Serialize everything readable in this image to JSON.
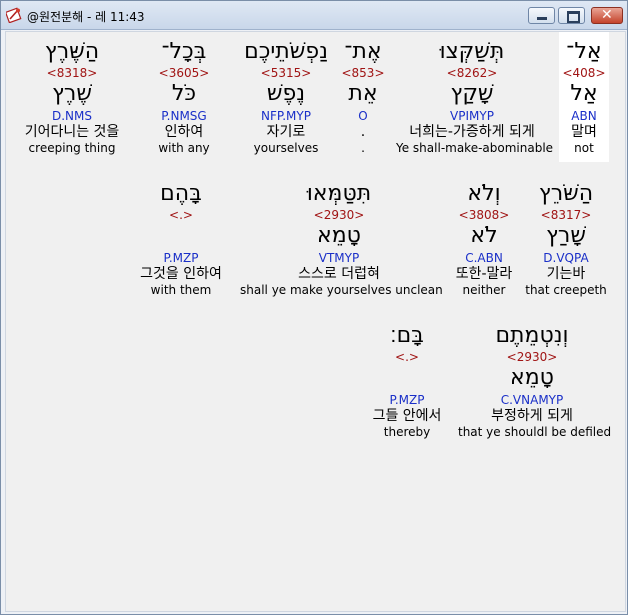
{
  "window": {
    "title": "@원전분해 - 레 11:43",
    "app_icon": "bible-parser-icon",
    "buttons": {
      "minimize": "minimize-icon",
      "maximize": "maximize-icon",
      "close": "✕"
    }
  },
  "rows": [
    [
      {
        "heb": "הַשֶּׁרֶץ",
        "strong": "<8318>",
        "lemma": "שֶׁרֶץ",
        "parse": "D.NMS",
        "kor": "기어다니는 것을",
        "eng": "creeping thing"
      },
      {
        "heb": "בְּכָל־",
        "strong": "<3605>",
        "lemma": "כֹּל",
        "parse": "P.NMSG",
        "kor": "인하여",
        "eng": "with any"
      },
      {
        "heb": "נַפְשֹׁתֵיכֶם",
        "strong": "<5315>",
        "lemma": "נֶפֶשׁ",
        "parse": "NFP.MYP",
        "kor": "자기로",
        "eng": "yourselves"
      },
      {
        "heb": "אֶת־",
        "strong": "<853>",
        "lemma": "אֵת",
        "parse": "O",
        "kor": ".",
        "eng": "."
      },
      {
        "heb": "תְּשַׁקְּצוּ",
        "strong": "<8262>",
        "lemma": "שָׁקַץ",
        "parse": "VPIMYP",
        "kor": "너희는-가증하게 되게",
        "eng": "Ye shall-make-abominable"
      },
      {
        "heb": "אַל־",
        "strong": "<408>",
        "lemma": "אַל",
        "parse": "ABN",
        "kor": "말며",
        "eng": "not",
        "highlight": true
      }
    ],
    [
      {
        "heb": "בָּהֶם",
        "strong": "<.>",
        "lemma": "",
        "parse": "P.MZP",
        "kor": "그것을 인하여",
        "eng": "with them"
      },
      {
        "heb": "תִּטַּמְּאוּ",
        "strong": "<2930>",
        "lemma": "טָמֵא",
        "parse": "VTMYP",
        "kor": "스스로 더럽혀",
        "eng": "shall ye make yourselves unclean"
      },
      {
        "heb": "וְלֹא",
        "strong": "<3808>",
        "lemma": "לֹא",
        "parse": "C.ABN",
        "kor": "또한-말라",
        "eng": "neither"
      },
      {
        "heb": "הַשֹּׁרֵץ",
        "strong": "<8317>",
        "lemma": "שָׁרַץ",
        "parse": "D.VQPA",
        "kor": "기는바",
        "eng": "that creepeth"
      }
    ],
    [
      {
        "heb": "בָּם׃",
        "strong": "<.>",
        "lemma": "",
        "parse": "P.MZP",
        "kor": "그들 안에서",
        "eng": "thereby"
      },
      {
        "heb": "וְנִטְמֵתֶם",
        "strong": "<2930>",
        "lemma": "טָמֵא",
        "parse": "C.VNAMYP",
        "kor": "부정하게 되게",
        "eng": "that ye shouldl be defiled"
      }
    ]
  ]
}
